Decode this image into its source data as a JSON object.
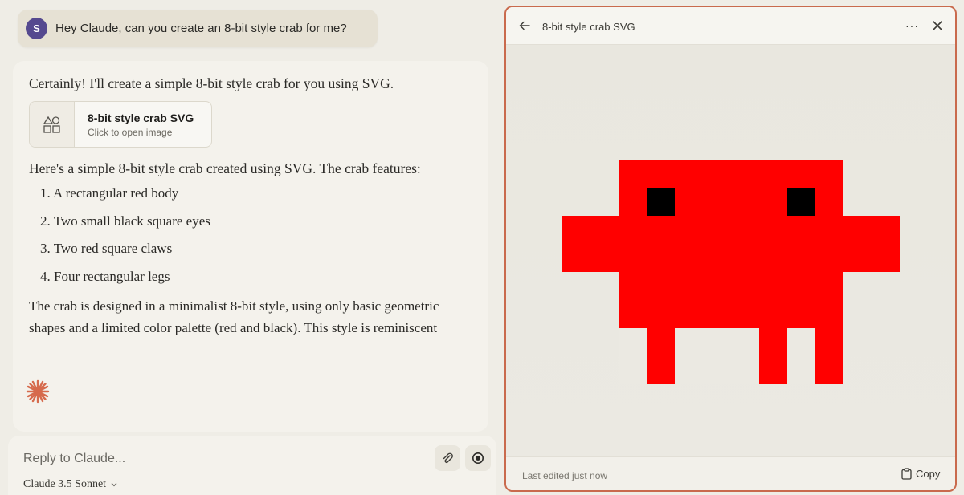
{
  "user": {
    "avatar_initial": "S",
    "message": "Hey Claude, can you create an 8-bit style crab for me?"
  },
  "assistant": {
    "intro": "Certainly! I'll create a simple 8-bit style crab for you using SVG.",
    "artifact_card": {
      "title": "8-bit style crab SVG",
      "subtitle": "Click to open image",
      "icon": "shapes-icon"
    },
    "lead": "Here's a simple 8-bit style crab created using SVG. The crab features:",
    "features": [
      "1. A rectangular red body",
      "2. Two small black square eyes",
      "3. Two red square claws",
      "4. Four rectangular legs"
    ],
    "paragraph": "The crab is designed in a minimalist 8-bit style, using only basic geometric shapes and a limited color palette (red and black). This style is reminiscent",
    "spinner_icon": "claude-spark-icon"
  },
  "reply": {
    "placeholder": "Reply to Claude...",
    "model": "Claude 3.5 Sonnet"
  },
  "artifact_panel": {
    "title": "8-bit style crab SVG",
    "more": "···",
    "footer_status": "Last edited just now",
    "copy_label": "Copy"
  },
  "colors": {
    "accent": "#c96a4d",
    "crab_red": "#ff0000",
    "eye_black": "#000000",
    "avatar": "#55498f"
  }
}
